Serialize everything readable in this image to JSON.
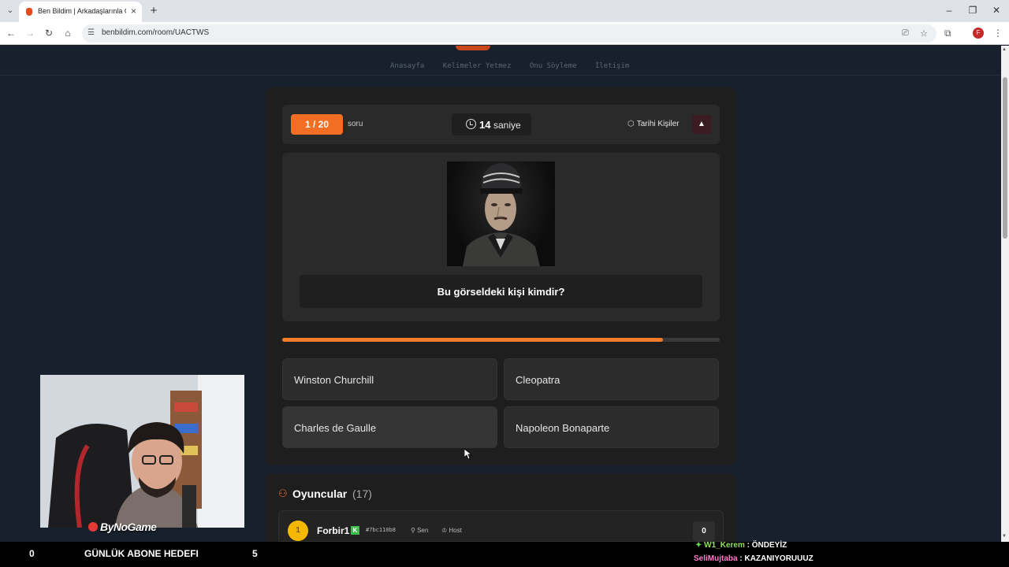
{
  "browser": {
    "tab_title": "Ben Bildim | Arkadaşlarınla Online",
    "url": "benbildim.com/room/UACTWS"
  },
  "site_nav": {
    "links": [
      "Anasayfa",
      "Kelimeler Yetmez",
      "Onu Söyleme",
      "İletişim"
    ]
  },
  "game": {
    "question_counter": "1 / 20",
    "question_counter_label": "soru",
    "timer_value": "14",
    "timer_label": "saniye",
    "category": "Tarihi Kişiler",
    "question": "Bu görseldeki kişi kimdir?",
    "time_progress": 0.87,
    "answers": [
      "Winston Churchill",
      "Cleopatra",
      "Charles de Gaulle",
      "Napoleon Bonaparte"
    ]
  },
  "players": {
    "title": "Oyuncular",
    "count": "(17)",
    "list": [
      {
        "rank": "1",
        "name": "Forbir1",
        "id": "#7bc110b8",
        "you_label": "Sen",
        "host_label": "Host",
        "score": "0"
      }
    ]
  },
  "stream": {
    "brand": "ByNoGame",
    "goal_current": "0",
    "goal_label": "GÜNLÜK ABONE HEDEFI",
    "goal_target": "5",
    "chat": [
      {
        "user": "W1_Kerem",
        "message": "ÖNDEYİZ"
      },
      {
        "user": "SeliMujtaba",
        "message": "KAZANIYORUUUZ"
      }
    ]
  },
  "colors": {
    "accent": "#f26e23",
    "page_bg": "#17202c",
    "panel_bg": "#1e1e1e"
  }
}
